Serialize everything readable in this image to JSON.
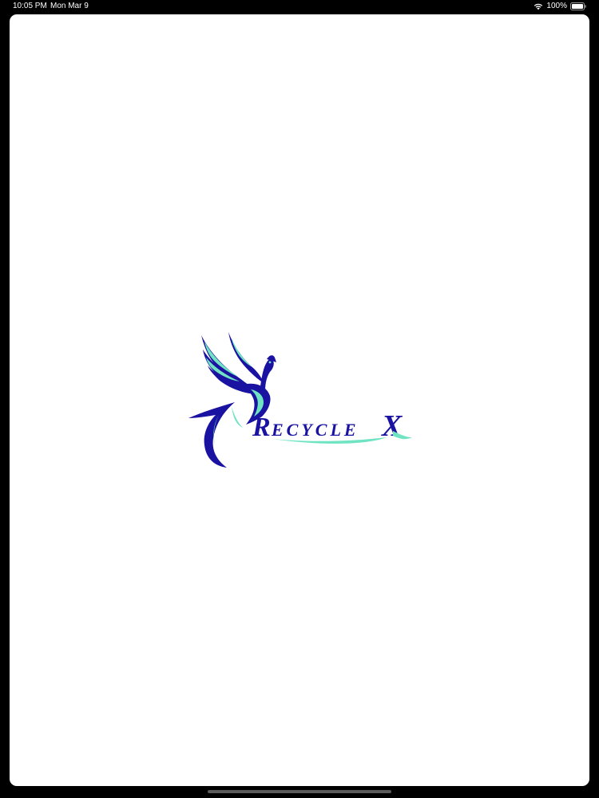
{
  "status_bar": {
    "time": "10:05 PM",
    "date": "Mon Mar 9",
    "battery_percent": "100%",
    "icons": [
      "wifi-icon",
      "battery-icon"
    ]
  },
  "splash": {
    "logo_text": "RecycleX",
    "logo_icon": "phoenix-icon"
  },
  "colors": {
    "background": "#000000",
    "sheet": "#ffffff",
    "brand_blue": "#1a12a0",
    "brand_teal": "#6fe3c2"
  }
}
